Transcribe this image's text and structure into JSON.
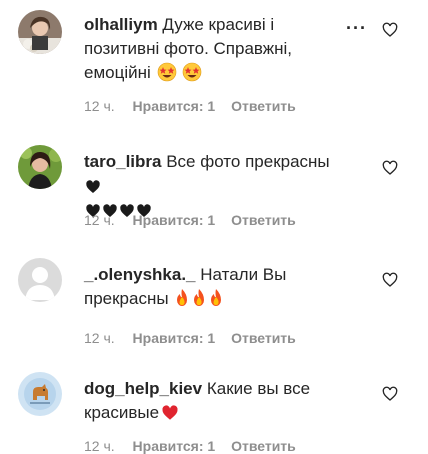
{
  "comments": [
    {
      "username": "olhalliym",
      "text_line1": "Дуже красиві і",
      "text_line2": "позитивні фото. Справжні,",
      "text_line3": "емоційні",
      "emoji": "star-struck-emoji x2",
      "time": "12 ч.",
      "likes": "Нравится: 1",
      "reply": "Ответить",
      "avatar_icon": "avatar-photo-woman-flowers"
    },
    {
      "username": "taro_libra",
      "text_line1": "Все фото прекрасны",
      "text_line2": "",
      "emoji": "black-heart-emoji x5",
      "time": "12 ч.",
      "likes": "Нравится: 1",
      "reply": "Ответить",
      "avatar_icon": "avatar-photo-woman"
    },
    {
      "username": "_.olenyshka._",
      "text_line1": "Натали Вы",
      "text_line2": "прекрасны",
      "emoji": "fire-emoji x3",
      "time": "12 ч.",
      "likes": "Нравится: 1",
      "reply": "Ответить",
      "avatar_icon": "default-avatar-icon"
    },
    {
      "username": "dog_help_kiev",
      "text_line1": "Какие вы все",
      "text_line2": "красивые",
      "emoji": "red-heart-emoji",
      "time": "12 ч.",
      "likes": "Нравится: 1",
      "reply": "Ответить",
      "avatar_icon": "avatar-dog-logo"
    }
  ],
  "more_options_icon": "more-options-icon",
  "like_icon": "heart-outline-icon"
}
